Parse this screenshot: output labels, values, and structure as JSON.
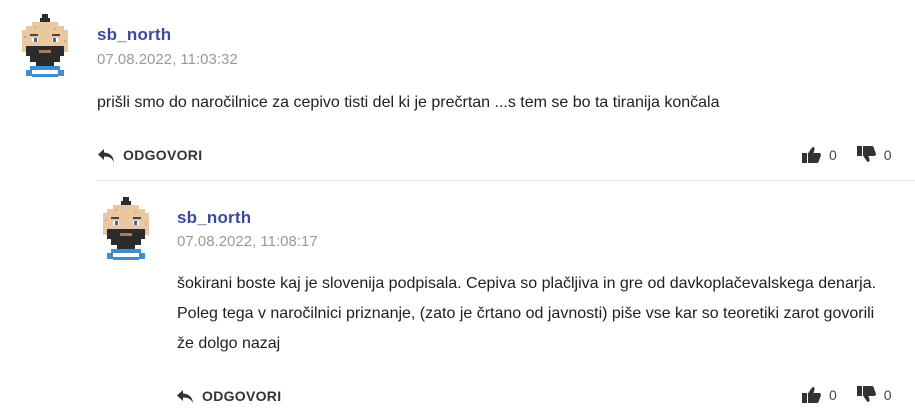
{
  "comments": [
    {
      "author": "sb_north",
      "date": "07.08.2022, 11:03:32",
      "text": "prišli smo do naročilnice za cepivo tisti del ki je prečrtan ...s tem se bo ta tiranija končala",
      "reply_label": "ODGOVORI",
      "likes": "0",
      "dislikes": "0"
    },
    {
      "author": "sb_north",
      "date": "07.08.2022, 11:08:17",
      "text": "šokirani boste kaj je slovenija podpisala. Cepiva so plačljiva in gre od davkoplačevalskega denarja. Poleg tega v naročilnici priznanje, (zato je črtano od javnosti) piše vse kar so teoretiki zarot govorili že dolgo nazaj",
      "reply_label": "ODGOVORI",
      "likes": "0",
      "dislikes": "0"
    }
  ],
  "icons": {
    "reply": "reply-arrow-icon",
    "like": "thumbs-up-icon",
    "dislike": "thumbs-down-icon",
    "avatar": "pixel-avatar-icon"
  },
  "colors": {
    "author": "#3b4a9b",
    "date": "#9a9a9a",
    "icon": "#333333"
  }
}
